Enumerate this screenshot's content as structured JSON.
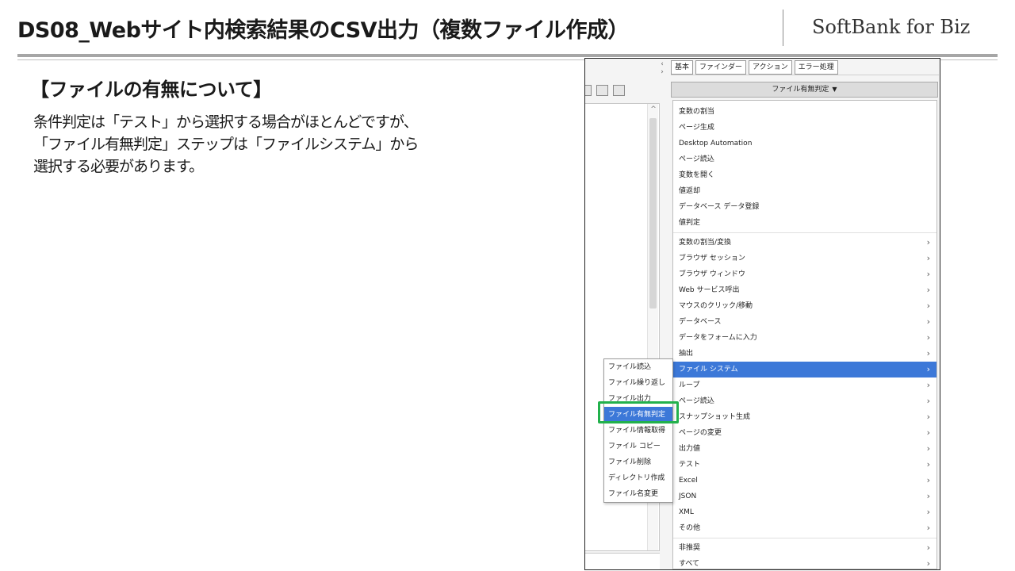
{
  "slide": {
    "title": "DS08_Webサイト内検索結果のCSV出力（複数ファイル作成）",
    "brand": "SoftBank for Biz",
    "heading": "【ファイルの有無について】",
    "body": [
      "条件判定は「テスト」から選択する場合がほとんどですが、",
      "「ファイル有無判定」ステップは「ファイルシステム」から",
      "選択する必要があります。"
    ]
  },
  "screenshot": {
    "tabs": [
      "基本",
      "ファインダー",
      "アクション",
      "エラー処理"
    ],
    "tab_arrow_left": "‹",
    "tab_arrow_right": "›",
    "scroll_up": "^",
    "dropdown_label": "ファイル有無判定",
    "dropdown_caret": "▼",
    "menu_group1": [
      "変数の割当",
      "ページ生成",
      "Desktop Automation",
      "ページ読込",
      "変数を開く",
      "値返却",
      "データベース データ登録",
      "値判定"
    ],
    "menu_group2": [
      "変数の割当/変換",
      "ブラウザ セッション",
      "ブラウザ ウィンドウ",
      "Web サービス呼出",
      "マウスのクリック/移動",
      "データベース",
      "データをフォームに入力",
      "抽出",
      "ファイル システム",
      "ループ",
      "ページ読込",
      "スナップショット生成",
      "ページの変更",
      "出力値",
      "テスト",
      "Excel",
      "JSON",
      "XML",
      "その他"
    ],
    "menu_group3": [
      "非推奨",
      "すべて"
    ],
    "submenu": [
      "ファイル読込",
      "ファイル繰り返し",
      "ファイル出力",
      "ファイル有無判定",
      "ファイル情報取得",
      "ファイル コピー",
      "ファイル削除",
      "ディレクトリ作成",
      "ファイル名変更"
    ],
    "accent_color": "#3c78d8",
    "highlight_box_color": "#22b14c"
  }
}
